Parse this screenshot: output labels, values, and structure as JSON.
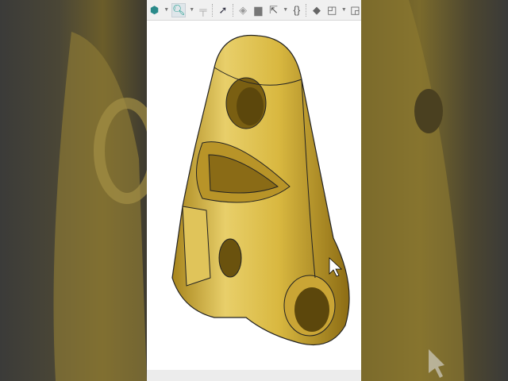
{
  "toolbar": {
    "icons": [
      "view-orientation-icon",
      "zoom-icon",
      "section-view-icon",
      "whats-wrong-icon",
      "rebuild-icon",
      "folder-icon",
      "export-icon",
      "equations-icon",
      "appearance-icon",
      "display-style-icon",
      "options-icon"
    ]
  },
  "colors": {
    "part_gold": "#d4b33a",
    "part_highlight": "#f6e79a",
    "part_shadow": "#7a5f12"
  }
}
